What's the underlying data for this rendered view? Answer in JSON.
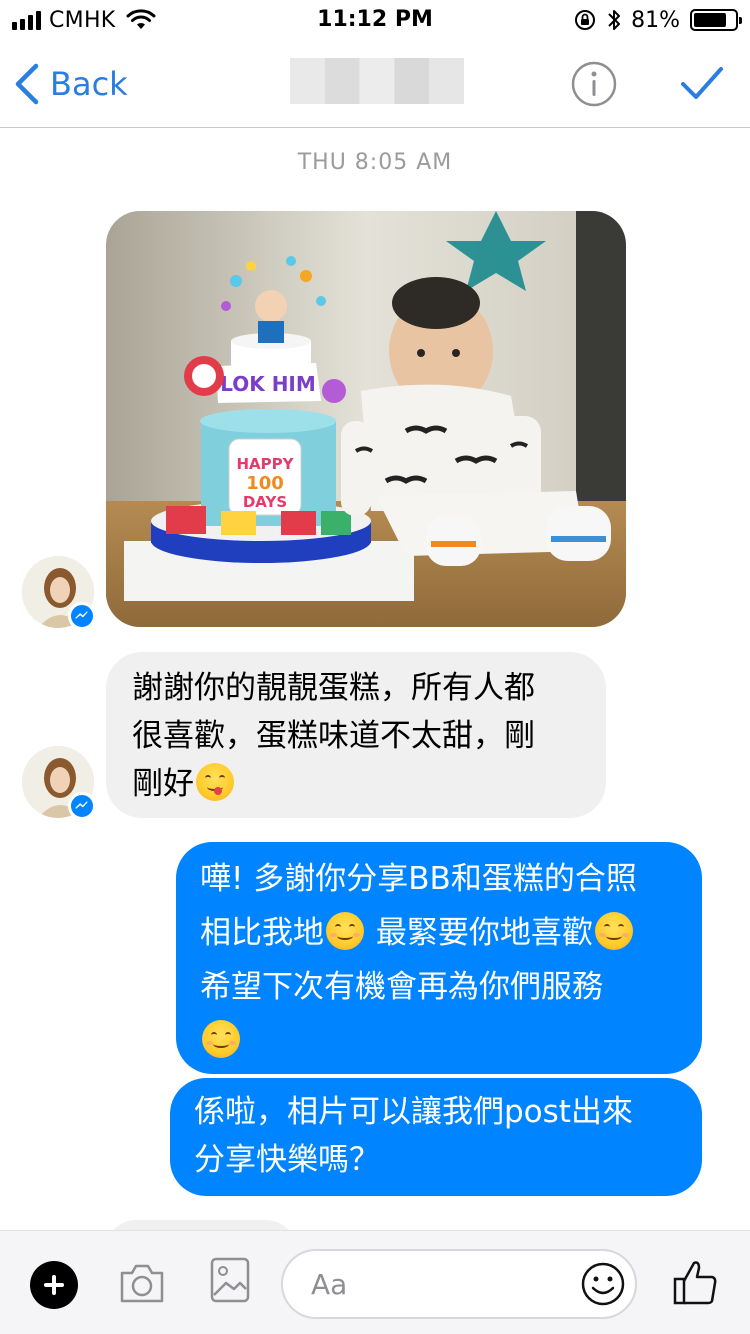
{
  "status_bar": {
    "carrier": "CMHK",
    "time": "11:12 PM",
    "battery_percent": "81%",
    "battery_level": 0.81
  },
  "nav": {
    "back_label": "Back"
  },
  "thread": {
    "timestamp": "THU 8:05 AM",
    "photo_text": {
      "banner": "LOK HIM",
      "plaque_line1": "HAPPY",
      "plaque_line2": "100",
      "plaque_line3": "DAYS"
    },
    "messages": [
      {
        "direction": "incoming",
        "lines": [
          "謝謝你的靚靚蛋糕，所有人都",
          "很喜歡，蛋糕味道不太甜，剛",
          "剛好"
        ]
      },
      {
        "direction": "outgoing",
        "lines": [
          "嘩! 多謝你分享BB和蛋糕的合照",
          "相比我地",
          " 最緊要你地喜歡",
          "希望下次有機會再為你們服務"
        ]
      },
      {
        "direction": "outgoing",
        "lines": [
          "係啦，相片可以讓我們post出來",
          "分享快樂嗎？"
        ]
      }
    ]
  },
  "composer": {
    "placeholder": "Aa"
  },
  "colors": {
    "accent": "#2a7de1",
    "outgoing_bubble": "#0084ff",
    "incoming_bubble": "#f1f0f0"
  },
  "icons": [
    "signal-icon",
    "wifi-icon",
    "orientation-lock-icon",
    "bluetooth-icon",
    "battery-icon",
    "back-chevron-icon",
    "info-icon",
    "checkmark-icon",
    "messenger-badge-icon",
    "plus-icon",
    "camera-icon",
    "image-icon",
    "smiley-icon",
    "thumbs-up-icon"
  ]
}
